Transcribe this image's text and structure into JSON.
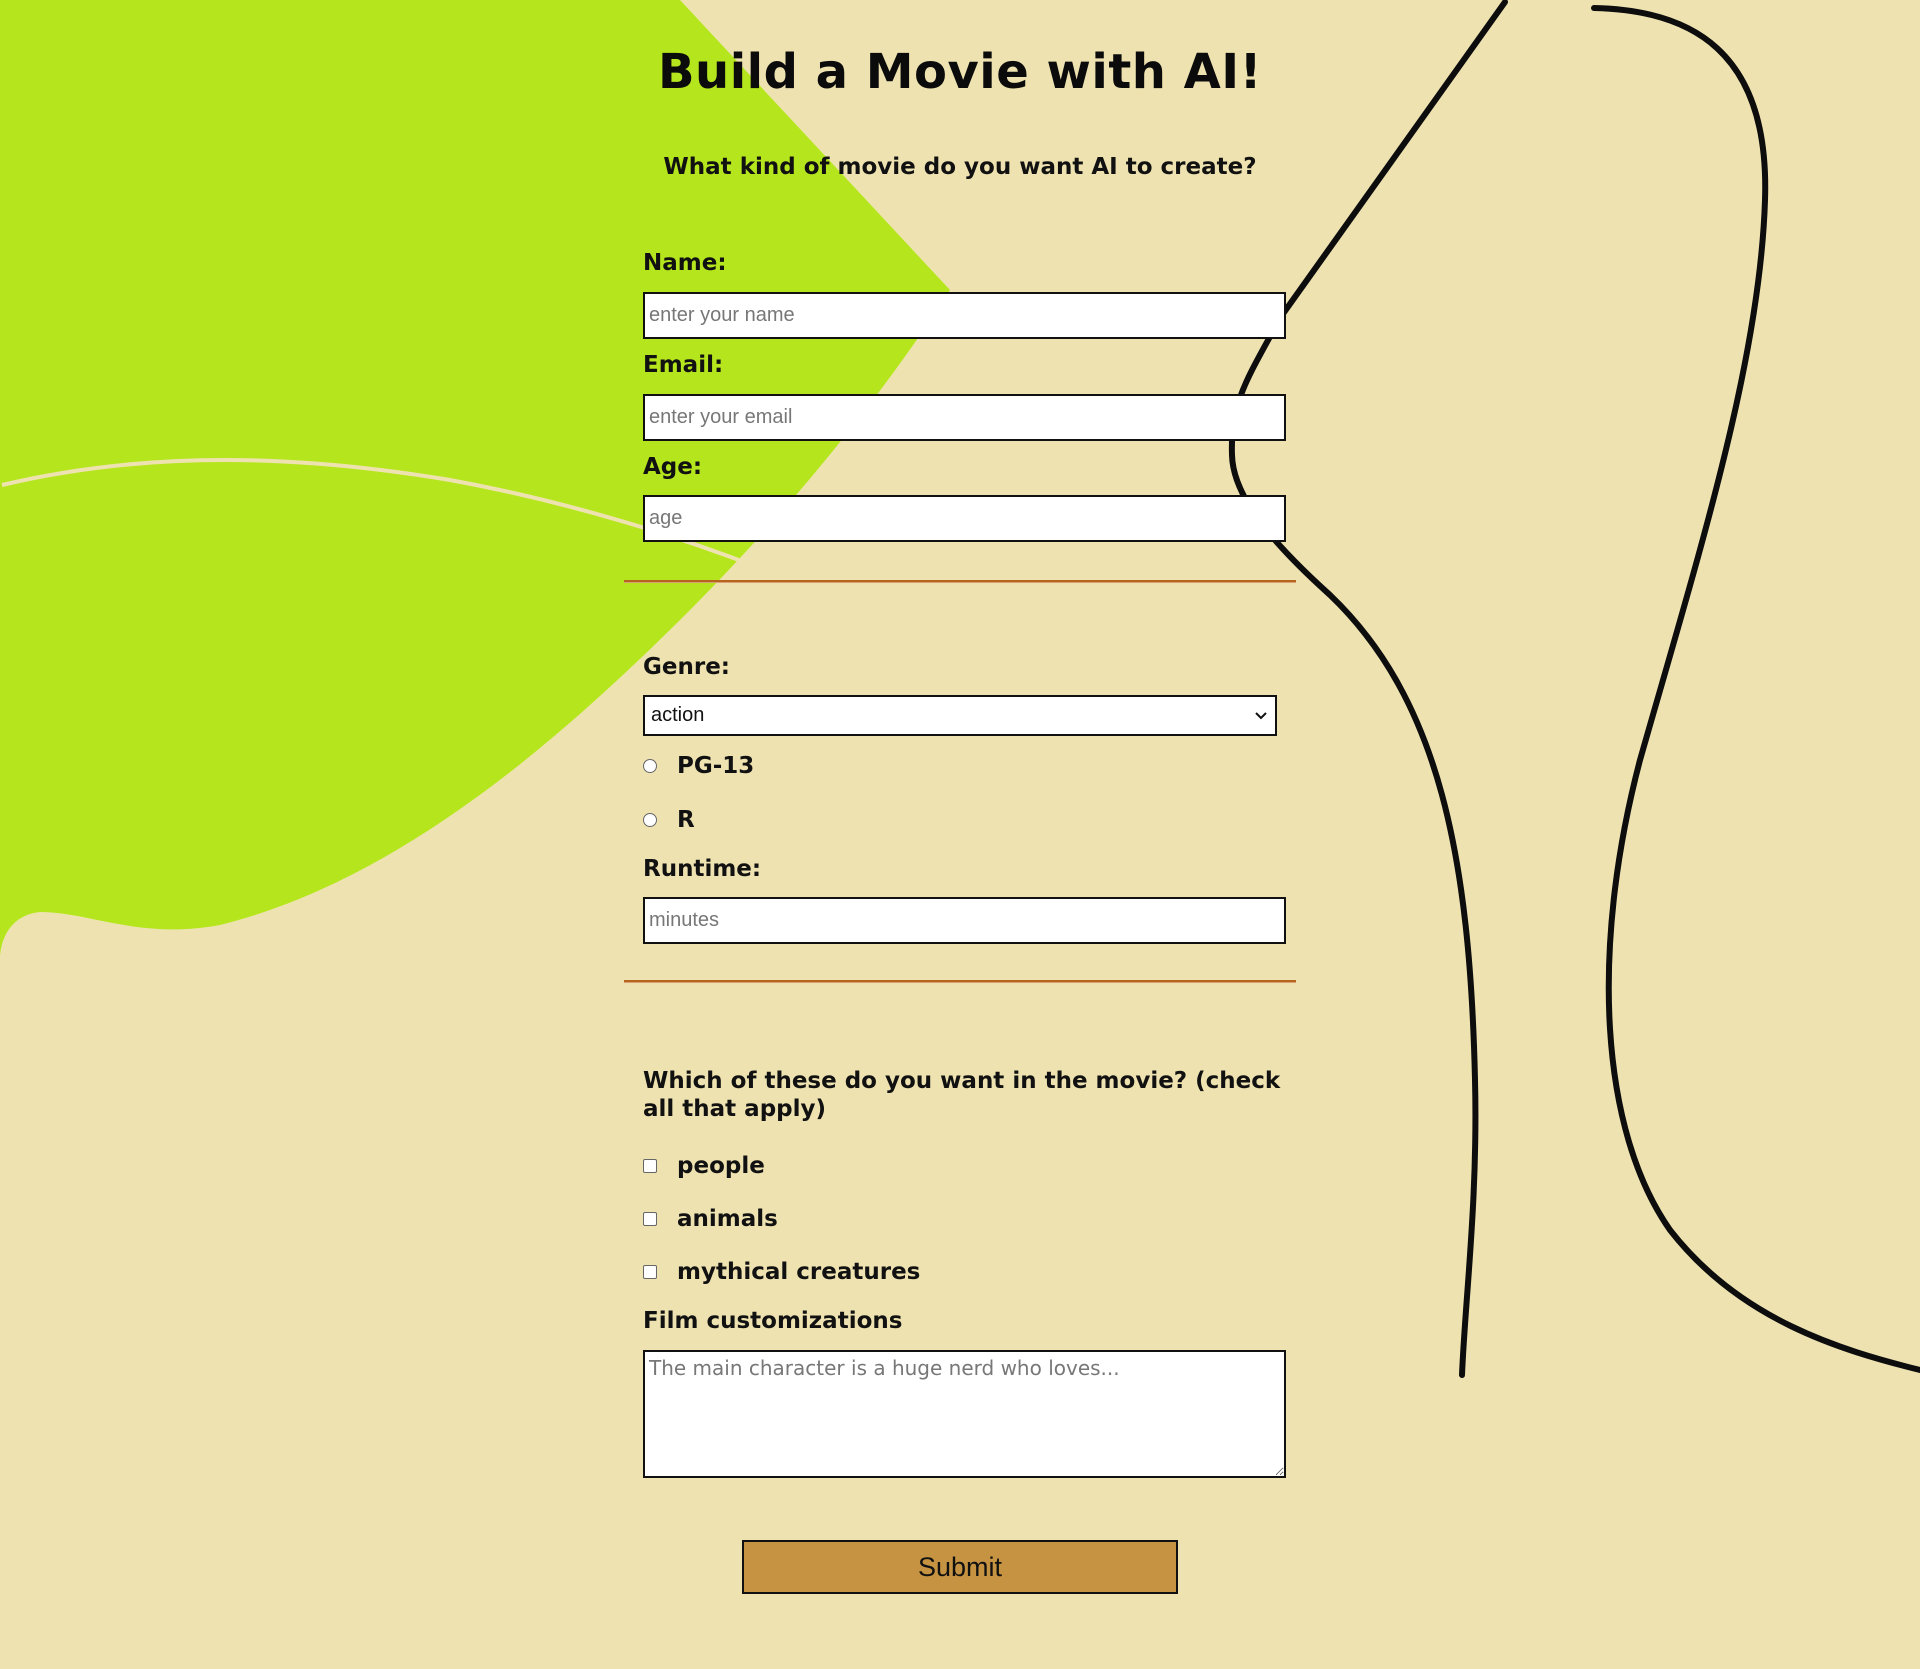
{
  "header": {
    "title": "Build a Movie with AI!",
    "subtitle": "What kind of movie do you want AI to create?"
  },
  "colors": {
    "background": "#eee3b0",
    "accent_shape": "#b5e61d",
    "rule": "#b5651d",
    "submit_bg": "#c59341"
  },
  "personal": {
    "name_label": "Name:",
    "name_placeholder": "enter your name",
    "email_label": "Email:",
    "email_placeholder": "enter your email",
    "age_label": "Age:",
    "age_placeholder": "age"
  },
  "movie": {
    "genre_label": "Genre:",
    "genre_selected": "action",
    "rating_options": [
      "PG-13",
      "R"
    ],
    "runtime_label": "Runtime:",
    "runtime_placeholder": "minutes"
  },
  "extras": {
    "question": "Which of these do you want in the movie? (check all that apply)",
    "options": [
      "people",
      "animals",
      "mythical creatures"
    ],
    "customizations_label": "Film customizations",
    "customizations_placeholder": "The main character is a huge nerd who loves..."
  },
  "submit_label": "Submit"
}
